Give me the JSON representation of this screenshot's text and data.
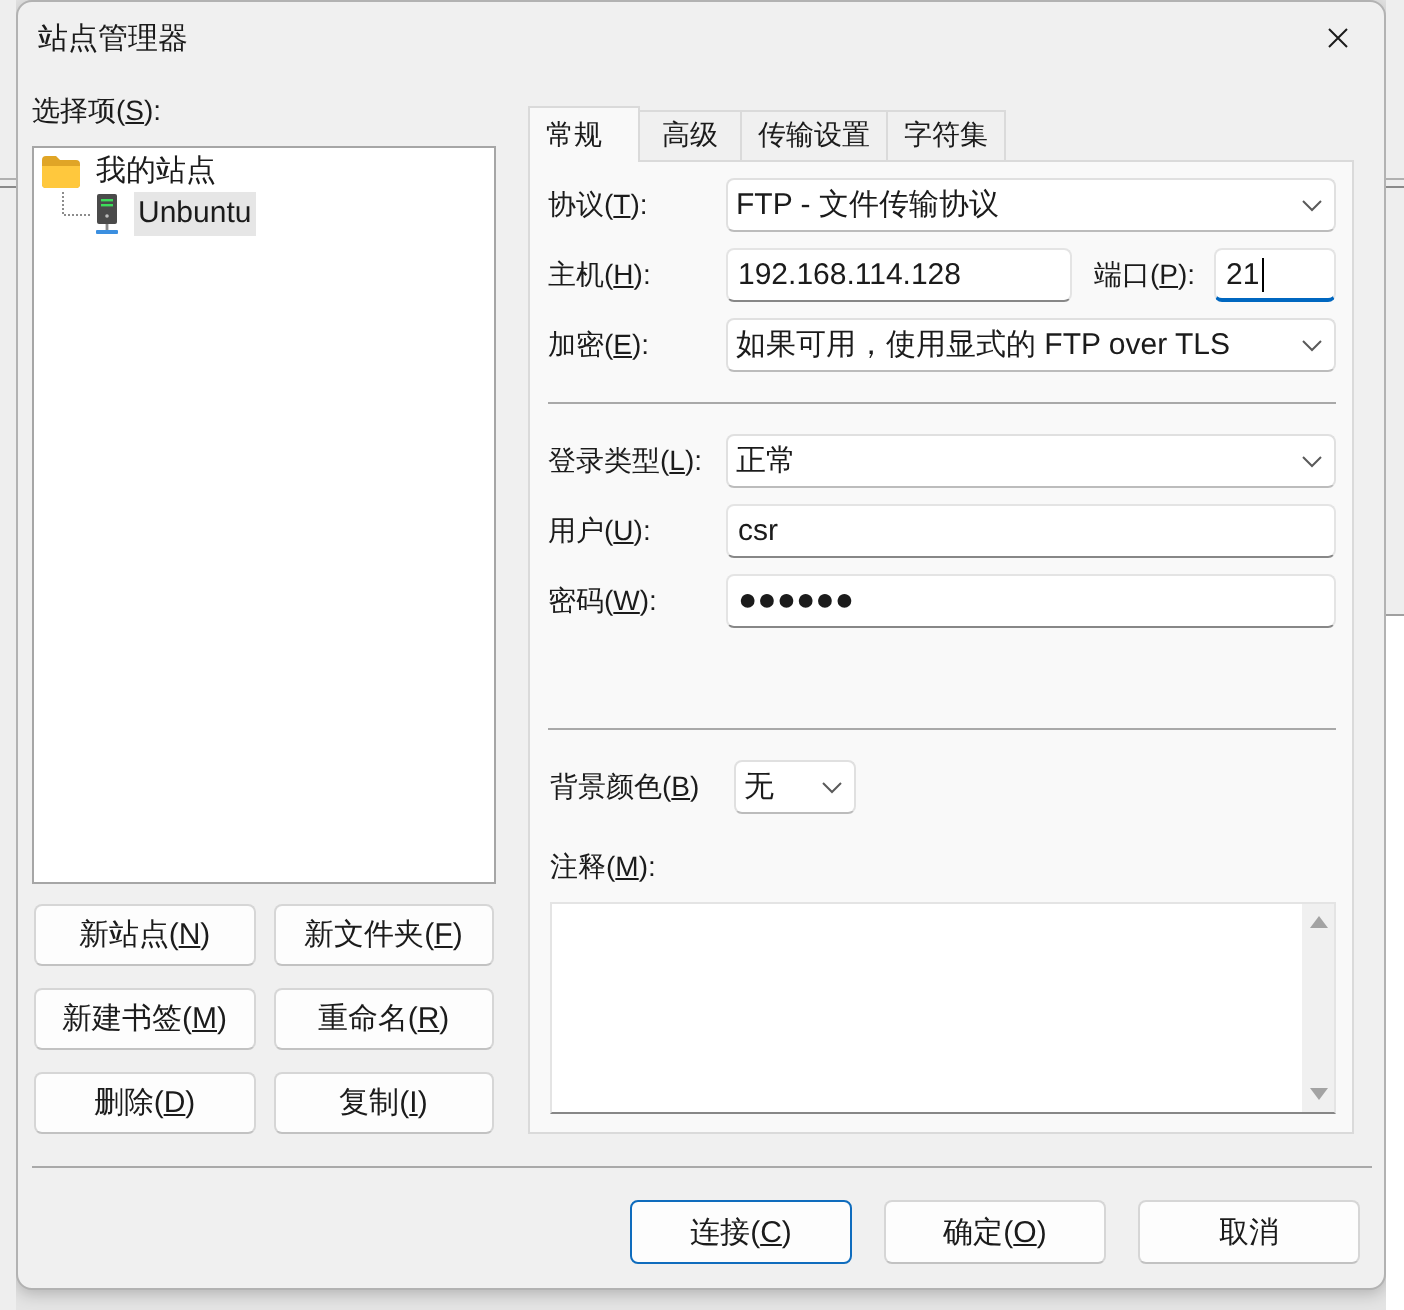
{
  "window": {
    "title": "站点管理器"
  },
  "site_list": {
    "label": "选择项(S):",
    "items": [
      {
        "label": "我的站点",
        "kind": "folder",
        "selected": false,
        "children": [
          {
            "label": "Unbuntu",
            "kind": "server",
            "selected": true
          }
        ]
      }
    ]
  },
  "site_buttons": [
    "新站点(N)",
    "新文件夹(F)",
    "新建书签(M)",
    "重命名(R)",
    "删除(D)",
    "复制(I)"
  ],
  "tabs": [
    {
      "label": "常规",
      "selected": true
    },
    {
      "label": "高级",
      "selected": false
    },
    {
      "label": "传输设置",
      "selected": false
    },
    {
      "label": "字符集",
      "selected": false
    }
  ],
  "general": {
    "connection": [
      {
        "kind": "dropdown",
        "label": "协议(T):",
        "value": "FTP - 文件传输协议"
      },
      {
        "kind": "host_port",
        "label": "主机(H):",
        "value": "192.168.114.128",
        "port": {
          "label": "端口(P):",
          "value": "21",
          "focused": true
        }
      },
      {
        "kind": "dropdown",
        "label": "加密(E):",
        "value": "如果可用，使用显式的 FTP over TLS"
      }
    ],
    "login": [
      {
        "kind": "dropdown",
        "label": "登录类型(L):",
        "value": "正常"
      },
      {
        "kind": "text",
        "label": "用户(U):",
        "value": "csr"
      },
      {
        "kind": "password",
        "label": "密码(W):",
        "value": "●●●●●●"
      }
    ],
    "background_color": {
      "label": "背景颜色(B)",
      "value": "无"
    },
    "comments": {
      "label": "注释(M):"
    }
  },
  "footer_buttons": [
    {
      "label": "连接(C)",
      "default": true
    },
    {
      "label": "确定(O)",
      "default": false
    },
    {
      "label": "取消",
      "default": false
    }
  ]
}
